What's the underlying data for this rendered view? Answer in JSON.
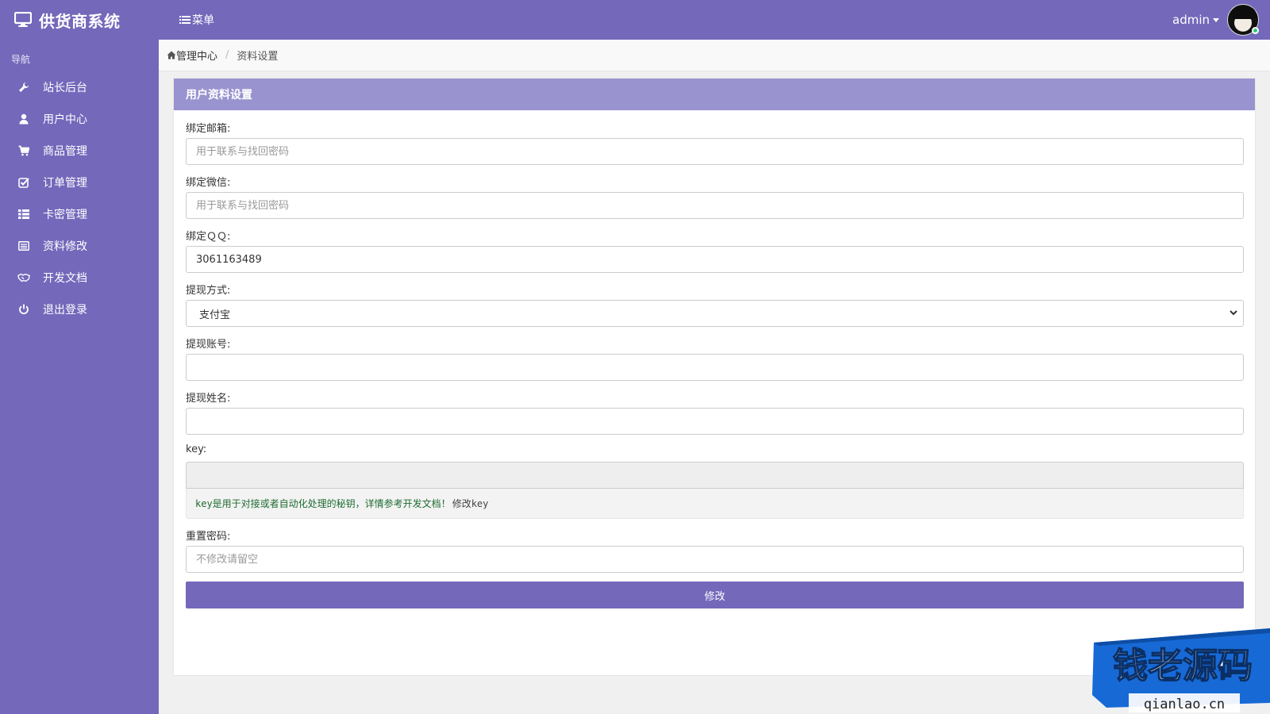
{
  "header": {
    "app_title": "供货商系统",
    "menu_label": "菜单",
    "username": "admin"
  },
  "sidebar": {
    "heading": "导航",
    "items": [
      {
        "label": "站长后台",
        "icon": "wrench-icon"
      },
      {
        "label": "用户中心",
        "icon": "user-icon"
      },
      {
        "label": "商品管理",
        "icon": "cart-icon"
      },
      {
        "label": "订单管理",
        "icon": "check-square-icon"
      },
      {
        "label": "卡密管理",
        "icon": "grid-icon"
      },
      {
        "label": "资料修改",
        "icon": "list-alt-icon"
      },
      {
        "label": "开发文档",
        "icon": "handshake-icon"
      },
      {
        "label": "退出登录",
        "icon": "power-icon"
      }
    ]
  },
  "breadcrumb": {
    "home": "管理中心",
    "current": "资料设置"
  },
  "panel": {
    "title": "用户资料设置"
  },
  "form": {
    "email_label": "绑定邮箱:",
    "email_value": "",
    "email_placeholder": "用于联系与找回密码",
    "wechat_label": "绑定微信:",
    "wechat_value": "",
    "wechat_placeholder": "用于联系与找回密码",
    "qq_label": "绑定ＱＱ:",
    "qq_value": "3061163489",
    "withdraw_method_label": "提现方式:",
    "withdraw_method_value": "支付宝",
    "withdraw_account_label": "提现账号:",
    "withdraw_account_value": "",
    "withdraw_name_label": "提现姓名:",
    "withdraw_name_value": "",
    "key_label": "key:",
    "key_value": "",
    "key_help": "key是用于对接或者自动化处理的秘钥，详情参考开发文档！",
    "key_help_link": "修改key",
    "password_label": "重置密码:",
    "password_value": "",
    "password_placeholder": "不修改请留空",
    "submit_label": "修改"
  },
  "watermark": {
    "main": "钱老源码",
    "sub": "qianlao.cn"
  },
  "colors": {
    "primary": "#7468bb",
    "panel_heading": "#9993cf",
    "watermark_blue": "#1769d6"
  }
}
